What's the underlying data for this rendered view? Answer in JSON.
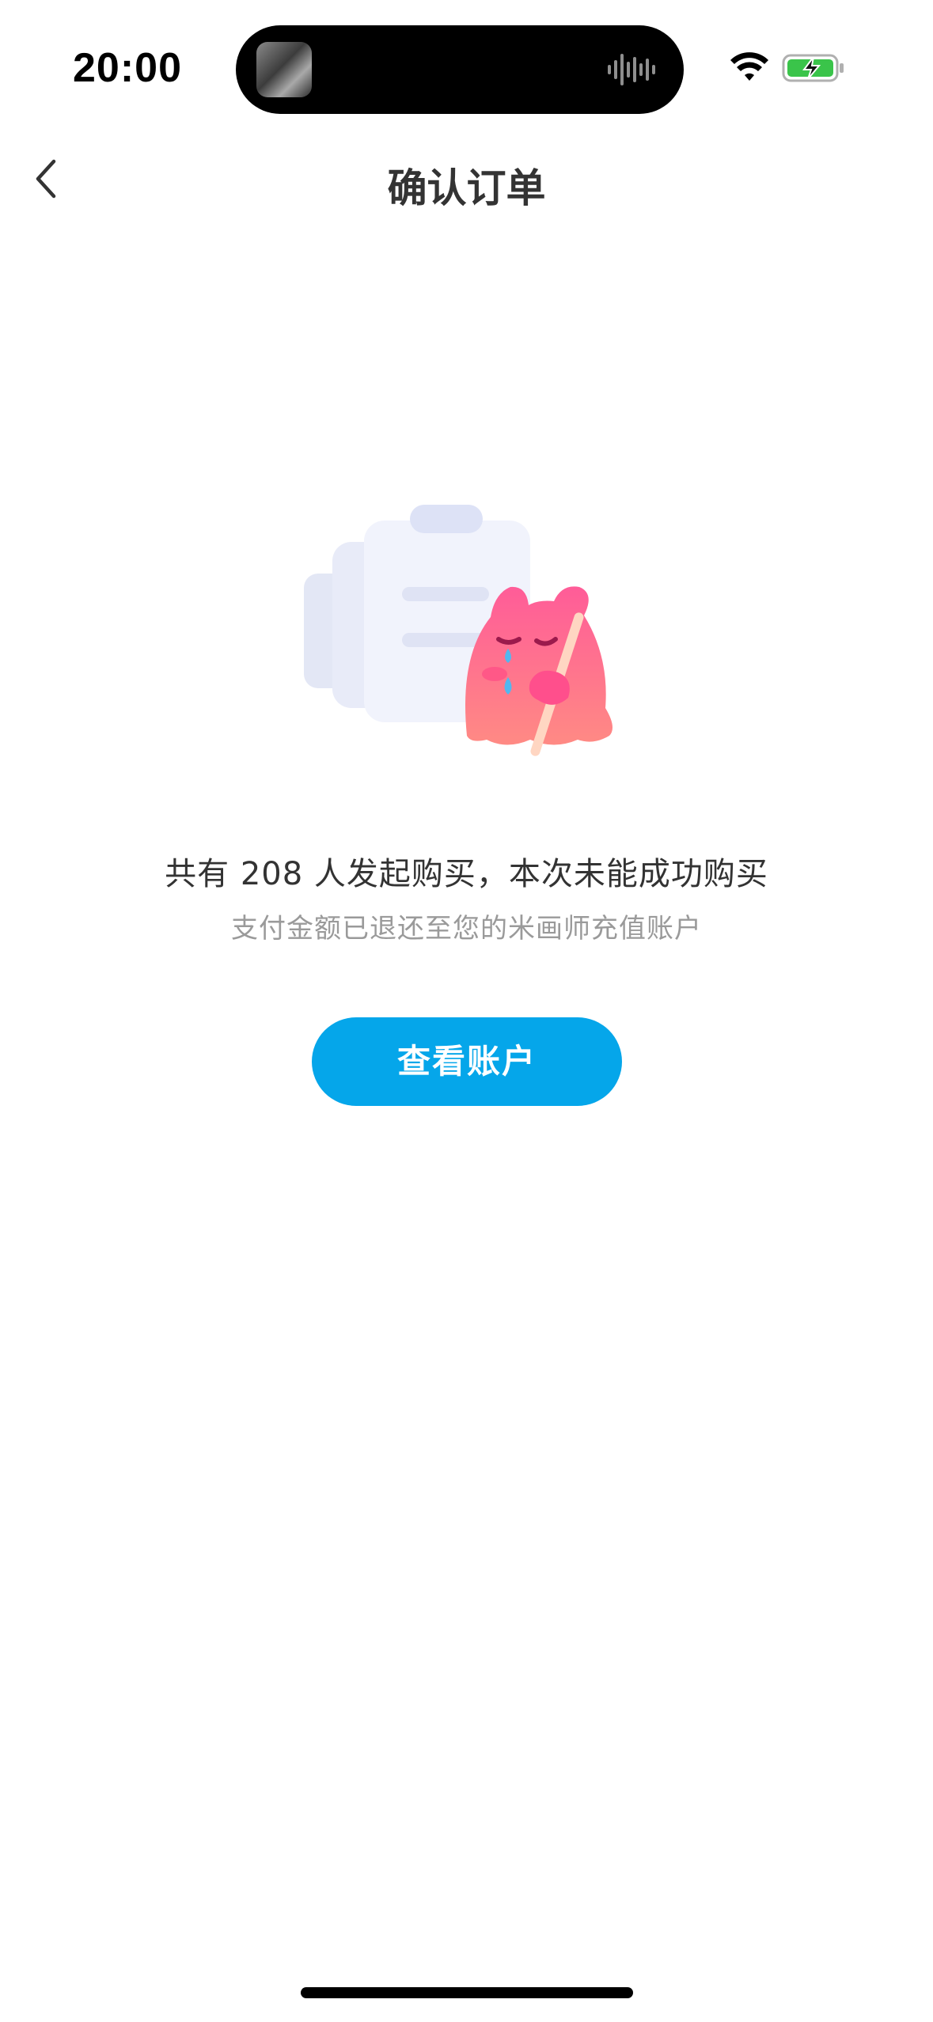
{
  "status_bar": {
    "time": "20:00",
    "icons": [
      "wifi-icon",
      "battery-charging-icon"
    ],
    "battery_color": "#3ac44a"
  },
  "nav": {
    "back_icon": "chevron-left-icon",
    "title": "确认订单"
  },
  "illustration": {
    "name": "crying-mascot-with-clipboard"
  },
  "main": {
    "message": "共有 208 人发起购买，本次未能成功购买",
    "submessage": "支付金额已退还至您的米画师充值账户",
    "button_label": "查看账户"
  },
  "colors": {
    "accent": "#05a6ea",
    "title_text": "#333333",
    "secondary_text": "#9a9a9a",
    "mascot_pink": "#ff6fa0"
  }
}
